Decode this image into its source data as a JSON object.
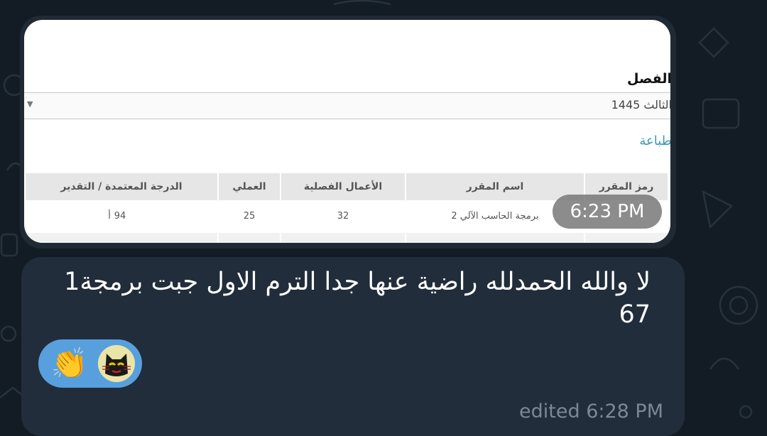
{
  "image_message": {
    "semester_label": "الفصل",
    "semester_value": "الثالث 1445",
    "print_link": "طباعة",
    "table": {
      "headers": [
        "رمز المقرر",
        "اسم المقرر",
        "الأعمال الفصلية",
        "العملي",
        "الدرجة المعتمدة / التقدير"
      ],
      "row": {
        "course_code": "",
        "course_name": "برمجة الحاسب الآلي 2",
        "coursework": "32",
        "practical": "25",
        "grade": "94",
        "letter": "أ"
      }
    },
    "time": "6:23 PM"
  },
  "text_message": {
    "text": "لا والله الحمدلله راضية عنها جدا الترم الاول جبت برمجة1\n67",
    "reactions": [
      {
        "icon": "clapping-hands-icon",
        "glyph": "👏"
      },
      {
        "icon": "cat-avatar-icon"
      }
    ],
    "status": "edited 6:28 PM"
  },
  "colors": {
    "background": "#131c25",
    "bubble": "#212d3b",
    "reaction": "#58a0dd",
    "link": "#3a9ab8"
  }
}
